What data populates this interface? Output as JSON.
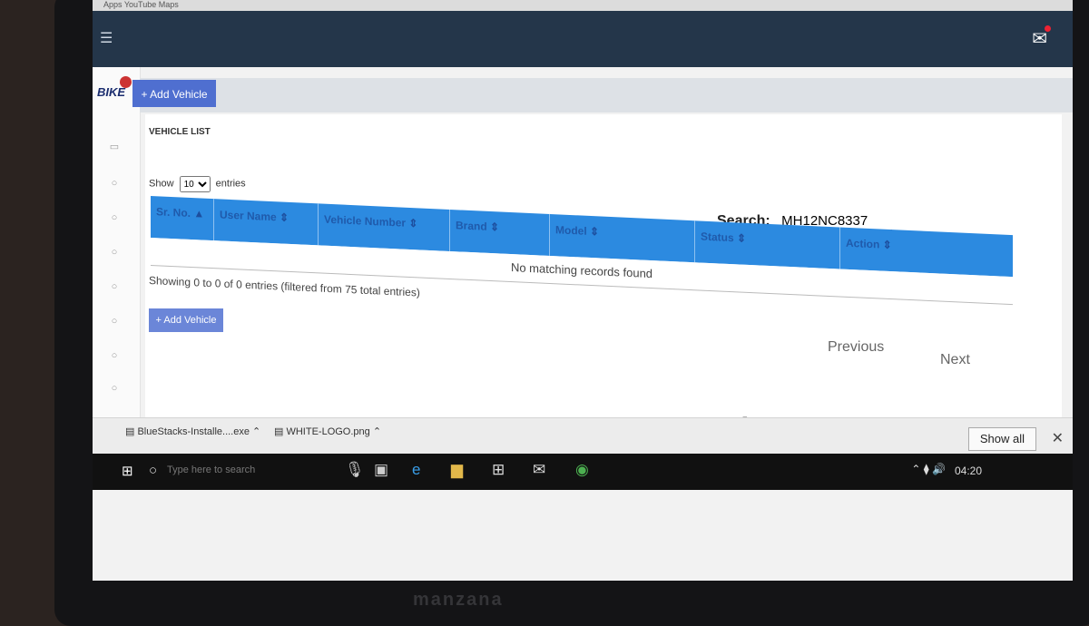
{
  "browser": {
    "tabs_text": "Apps  YouTube  Maps"
  },
  "app": {
    "logo_text": "BIKE",
    "add_vehicle_label": "+ Add Vehicle",
    "page_title": "VEHICLE LIST"
  },
  "entries": {
    "show_label": "Show",
    "per_page": "10",
    "entries_label": "entries"
  },
  "search": {
    "label": "Search:",
    "value": "MH12NC8337"
  },
  "table": {
    "columns": [
      "Sr. No.",
      "User Name",
      "Vehicle Number",
      "Brand",
      "Model",
      "Status",
      "Action"
    ],
    "empty_message": "No matching records found",
    "info": "Showing 0 to 0 of 0 entries (filtered from 75 total entries)"
  },
  "pagination": {
    "previous": "Previous",
    "next": "Next"
  },
  "downloads": {
    "items": [
      "BlueStacks-Installe....exe",
      "WHITE-LOGO.png"
    ],
    "show_all": "Show all"
  },
  "taskbar": {
    "search_placeholder": "Type here to search",
    "time": "04:20"
  },
  "monitor_brand": "manzana"
}
